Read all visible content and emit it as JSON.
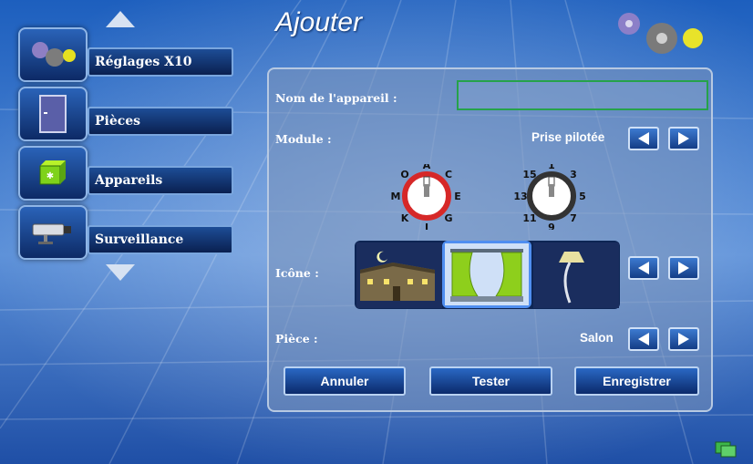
{
  "window": {
    "title": "Ajouter"
  },
  "nav": {
    "scroll_up": "arrow-up",
    "scroll_down": "arrow-down",
    "items": [
      {
        "label": "Réglages X10",
        "icon": "gears-icon"
      },
      {
        "label": "Pièces",
        "icon": "door-icon"
      },
      {
        "label": "Appareils",
        "icon": "device-box-icon"
      },
      {
        "label": "Surveillance",
        "icon": "camera-icon"
      }
    ]
  },
  "form": {
    "name": {
      "label": "Nom de l'appareil :",
      "value": ""
    },
    "module": {
      "label": "Module :",
      "value": "Prise pilotée"
    },
    "dials": {
      "house_code": [
        "A",
        "C",
        "E",
        "G",
        "I",
        "K",
        "M",
        "O"
      ],
      "unit_code": [
        "1",
        "3",
        "5",
        "7",
        "9",
        "11",
        "13",
        "15"
      ]
    },
    "icon": {
      "label": "Icône :",
      "options": [
        "house-night-icon",
        "window-curtains-icon",
        "floor-lamp-icon"
      ],
      "selected": 1
    },
    "room": {
      "label": "Pièce :",
      "value": "Salon"
    }
  },
  "buttons": {
    "cancel": "Annuler",
    "test": "Tester",
    "save": "Enregistrer"
  },
  "colors": {
    "accent": "#1d4d96",
    "name_field_border": "#26a24a",
    "dial_red": "#d62828",
    "icon_selected_border": "#4f8ef0"
  }
}
